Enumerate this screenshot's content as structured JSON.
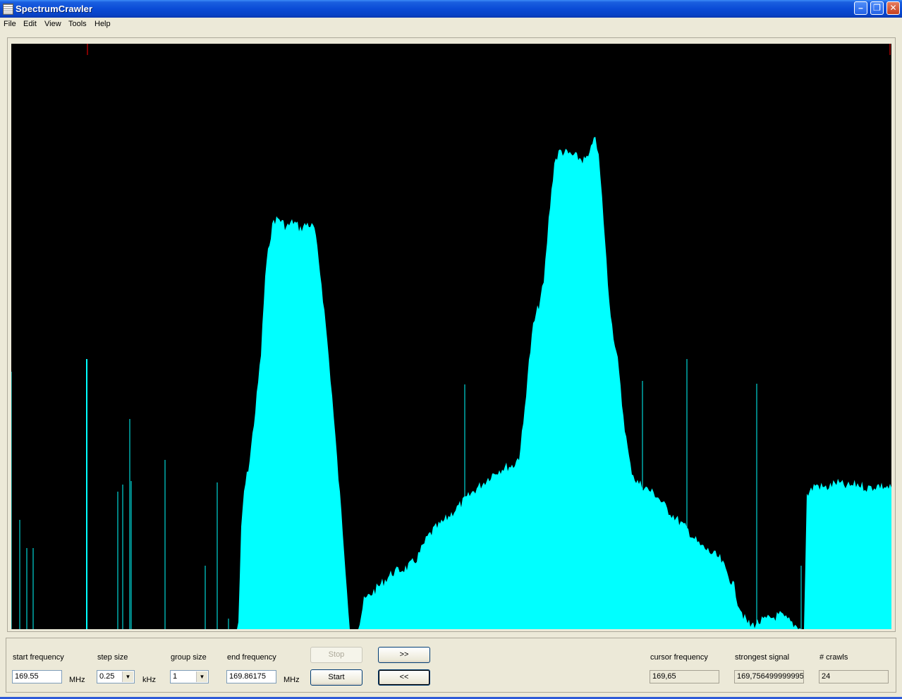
{
  "window": {
    "title": "SpectrumCrawler"
  },
  "menu": [
    "File",
    "Edit",
    "View",
    "Tools",
    "Help"
  ],
  "spectrum": {
    "background": "#000000",
    "trace_color": "#00ffff",
    "marker_color": "#ff0000"
  },
  "controls": {
    "start_frequency": {
      "label": "start frequency",
      "value": "169.55",
      "unit": "MHz"
    },
    "step_size": {
      "label": "step size",
      "value": "0.25",
      "unit": "kHz"
    },
    "group_size": {
      "label": "group size",
      "value": "1"
    },
    "end_frequency": {
      "label": "end frequency",
      "value": "169.86175",
      "unit": "MHz"
    },
    "stop_label": "Stop",
    "start_label": "Start",
    "forward_label": ">>",
    "back_label": "<<",
    "cursor_frequency": {
      "label": "cursor frequency",
      "value": "169,65"
    },
    "strongest_signal": {
      "label": "strongest signal",
      "value": "169,756499999995"
    },
    "crawls": {
      "label": "# crawls",
      "value": "24"
    }
  }
}
